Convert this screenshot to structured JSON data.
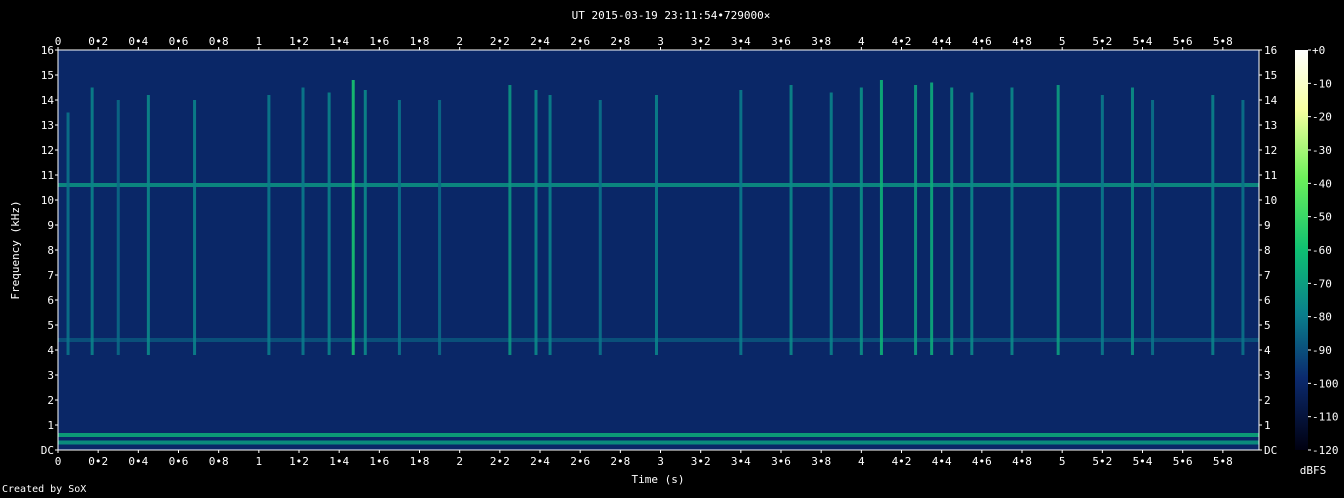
{
  "chart_data": {
    "type": "heatmap",
    "title": "UT 2015-03-19 23:11:54•729000×",
    "xlabel": "Time (s)",
    "ylabel": "Frequency (kHz)",
    "xlim": [
      0,
      5.98
    ],
    "ylim": [
      0,
      16
    ],
    "x_ticks": [
      "0",
      "0•2",
      "0•4",
      "0•6",
      "0•8",
      "1",
      "1•2",
      "1•4",
      "1•6",
      "1•8",
      "2",
      "2•2",
      "2•4",
      "2•6",
      "2•8",
      "3",
      "3•2",
      "3•4",
      "3•6",
      "3•8",
      "4",
      "4•2",
      "4•4",
      "4•6",
      "4•8",
      "5",
      "5•2",
      "5•4",
      "5•6",
      "5•8"
    ],
    "y_ticks": [
      "DC",
      "1",
      "2",
      "3",
      "4",
      "5",
      "6",
      "7",
      "8",
      "9",
      "10",
      "11",
      "12",
      "13",
      "14",
      "15",
      "16"
    ],
    "colorbar": {
      "label": "dBFS",
      "ticks": [
        "+0",
        "-10",
        "-20",
        "-30",
        "-40",
        "-50",
        "-60",
        "-70",
        "-80",
        "-90",
        "-100",
        "-110",
        "-120"
      ]
    },
    "background_level": -100,
    "horizontal_lines_khz": [
      {
        "freq": 10.6,
        "level": -72
      },
      {
        "freq": 0.6,
        "level": -65
      },
      {
        "freq": 0.3,
        "level": -70
      },
      {
        "freq": 4.4,
        "level": -88
      }
    ],
    "impulses": [
      {
        "t": 0.05,
        "fmax": 13.5,
        "level": -82
      },
      {
        "t": 0.17,
        "fmax": 14.5,
        "level": -78
      },
      {
        "t": 0.3,
        "fmax": 14.0,
        "level": -84
      },
      {
        "t": 0.45,
        "fmax": 14.2,
        "level": -76
      },
      {
        "t": 0.68,
        "fmax": 14.0,
        "level": -78
      },
      {
        "t": 1.05,
        "fmax": 14.2,
        "level": -80
      },
      {
        "t": 1.22,
        "fmax": 14.5,
        "level": -80
      },
      {
        "t": 1.35,
        "fmax": 14.3,
        "level": -78
      },
      {
        "t": 1.47,
        "fmax": 14.8,
        "level": -58
      },
      {
        "t": 1.53,
        "fmax": 14.4,
        "level": -76
      },
      {
        "t": 1.7,
        "fmax": 14.0,
        "level": -82
      },
      {
        "t": 1.9,
        "fmax": 14.0,
        "level": -84
      },
      {
        "t": 2.25,
        "fmax": 14.6,
        "level": -72
      },
      {
        "t": 2.38,
        "fmax": 14.4,
        "level": -76
      },
      {
        "t": 2.45,
        "fmax": 14.2,
        "level": -78
      },
      {
        "t": 2.7,
        "fmax": 14.0,
        "level": -82
      },
      {
        "t": 2.98,
        "fmax": 14.2,
        "level": -78
      },
      {
        "t": 3.4,
        "fmax": 14.4,
        "level": -80
      },
      {
        "t": 3.65,
        "fmax": 14.6,
        "level": -76
      },
      {
        "t": 3.85,
        "fmax": 14.3,
        "level": -78
      },
      {
        "t": 4.0,
        "fmax": 14.5,
        "level": -74
      },
      {
        "t": 4.1,
        "fmax": 14.8,
        "level": -64
      },
      {
        "t": 4.27,
        "fmax": 14.6,
        "level": -70
      },
      {
        "t": 4.35,
        "fmax": 14.7,
        "level": -66
      },
      {
        "t": 4.45,
        "fmax": 14.5,
        "level": -72
      },
      {
        "t": 4.55,
        "fmax": 14.3,
        "level": -76
      },
      {
        "t": 4.75,
        "fmax": 14.5,
        "level": -76
      },
      {
        "t": 4.98,
        "fmax": 14.6,
        "level": -70
      },
      {
        "t": 5.2,
        "fmax": 14.2,
        "level": -80
      },
      {
        "t": 5.35,
        "fmax": 14.5,
        "level": -74
      },
      {
        "t": 5.45,
        "fmax": 14.0,
        "level": -82
      },
      {
        "t": 5.75,
        "fmax": 14.2,
        "level": -78
      },
      {
        "t": 5.9,
        "fmax": 14.0,
        "level": -82
      }
    ],
    "grid": false
  },
  "credit": "Created by SoX"
}
